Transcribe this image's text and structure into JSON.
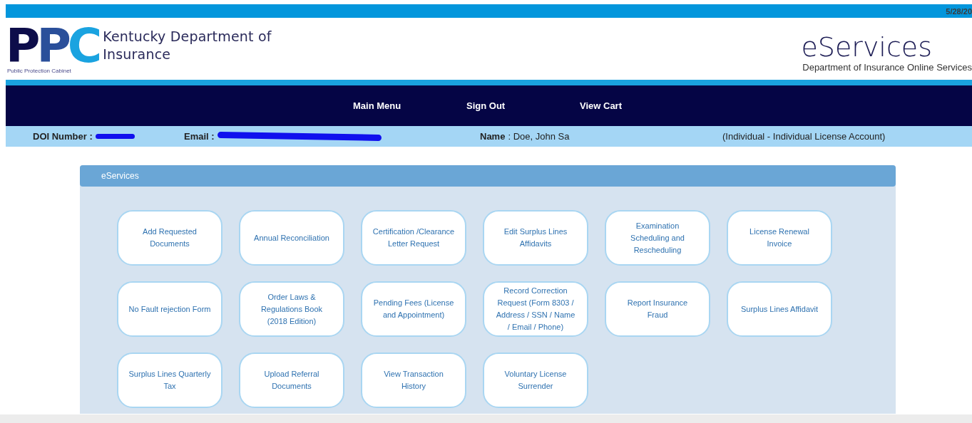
{
  "top_bar": {
    "date": "5/28/20"
  },
  "header": {
    "logo": {
      "letters": [
        "P",
        "P",
        "C"
      ],
      "caption": "Public Protection Cabinet"
    },
    "agency": "Kentucky Department of Insurance",
    "title": "eServices",
    "subtitle": "Department of Insurance Online Services"
  },
  "nav": {
    "items": [
      "Main Menu",
      "Sign Out",
      "View Cart"
    ]
  },
  "account_bar": {
    "doi_label": "DOI Number :",
    "email_label": "Email :",
    "name_label": "Name",
    "name_value": ": Doe, John Sa",
    "account_type": "(Individual - Individual License Account)"
  },
  "panel": {
    "title": "eServices",
    "buttons": [
      "Add Requested Documents",
      "Annual Reconciliation",
      "Certification /Clearance Letter Request",
      "Edit Surplus Lines Affidavits",
      "Examination Scheduling and Rescheduling",
      "License Renewal Invoice",
      "No Fault rejection Form",
      "Order Laws & Regulations Book (2018 Edition)",
      "Pending Fees (License and Appointment)",
      "Record Correction Request (Form 8303 / Address / SSN / Name / Email / Phone)",
      "Report Insurance Fraud",
      "Surplus Lines Affidavit",
      "Surplus Lines Quarterly Tax",
      "Upload Referral Documents",
      "View Transaction History",
      "Voluntary License Surrender"
    ]
  }
}
